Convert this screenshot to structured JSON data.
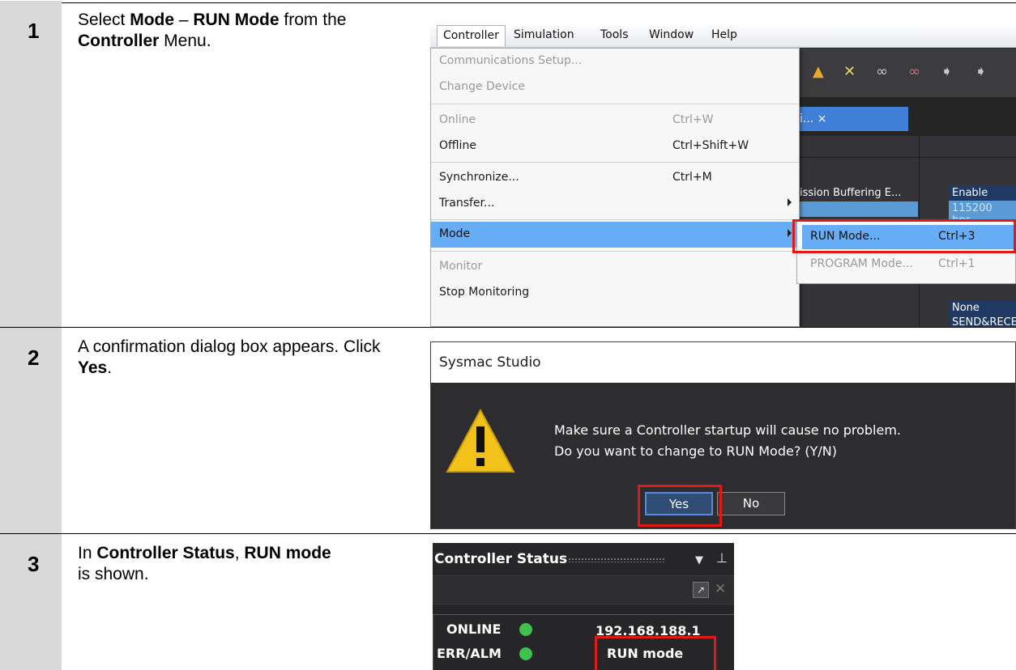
{
  "steps": [
    {
      "number": "1",
      "pre": "Select ",
      "b1": "Mode",
      "mid1": " – ",
      "b2": "RUN Mode",
      "mid2": " from the ",
      "b3": "Controller",
      "post": " Menu."
    },
    {
      "number": "2",
      "pre": "A confirmation dialog box appears. Click ",
      "b1": "Yes",
      "post": "."
    },
    {
      "number": "3",
      "pre": "In ",
      "b1": "Controller Status",
      "mid1": ", ",
      "b2": "RUN mode",
      "post": " is shown."
    }
  ],
  "menubar": {
    "items": [
      "Controller",
      "Simulation",
      "Tools",
      "Window",
      "Help"
    ]
  },
  "controller_menu": {
    "items": [
      {
        "label": "Communications Setup...",
        "shortcut": "",
        "state": "disabled"
      },
      {
        "label": "Change Device",
        "shortcut": "",
        "state": "disabled"
      },
      {
        "label": "Online",
        "shortcut": "Ctrl+W",
        "state": "disabled"
      },
      {
        "label": "Offline",
        "shortcut": "Ctrl+Shift+W",
        "state": "enabled"
      },
      {
        "label": "Synchronize...",
        "shortcut": "Ctrl+M",
        "state": "enabled"
      },
      {
        "label": "Transfer...",
        "shortcut": "",
        "state": "enabled",
        "submenu": true
      },
      {
        "label": "Mode",
        "shortcut": "",
        "state": "highlighted",
        "submenu": true
      },
      {
        "label": "Monitor",
        "shortcut": "",
        "state": "disabled"
      },
      {
        "label": "Stop Monitoring",
        "shortcut": "",
        "state": "enabled"
      }
    ]
  },
  "mode_submenu": {
    "items": [
      {
        "label": "RUN Mode...",
        "shortcut": "Ctrl+3",
        "state": "highlighted"
      },
      {
        "label": "PROGRAM Mode...",
        "shortcut": "Ctrl+1",
        "state": "disabled"
      }
    ]
  },
  "background_editor": {
    "tab_label": "i... ×",
    "cell_label": "ission Buffering E...",
    "cell_values": [
      "Enable",
      "115200 bps",
      "None",
      "SEND&RECE"
    ]
  },
  "dialog": {
    "title": "Sysmac Studio",
    "message_line1": "Make sure a Controller startup will cause no problem.",
    "message_line2": "Do you want to change to RUN Mode? (Y/N)",
    "yes_label": "Yes",
    "no_label": "No"
  },
  "controller_status": {
    "title": "Controller Status",
    "rows": [
      {
        "label": "ONLINE",
        "value": "192.168.188.1"
      },
      {
        "label": "ERR/ALM",
        "value": "RUN mode"
      }
    ],
    "led_color": "#3ec24d"
  },
  "colors": {
    "highlight_red": "#e01818",
    "menu_highlight": "#66adf5",
    "step_column": "#d9d9d9"
  }
}
